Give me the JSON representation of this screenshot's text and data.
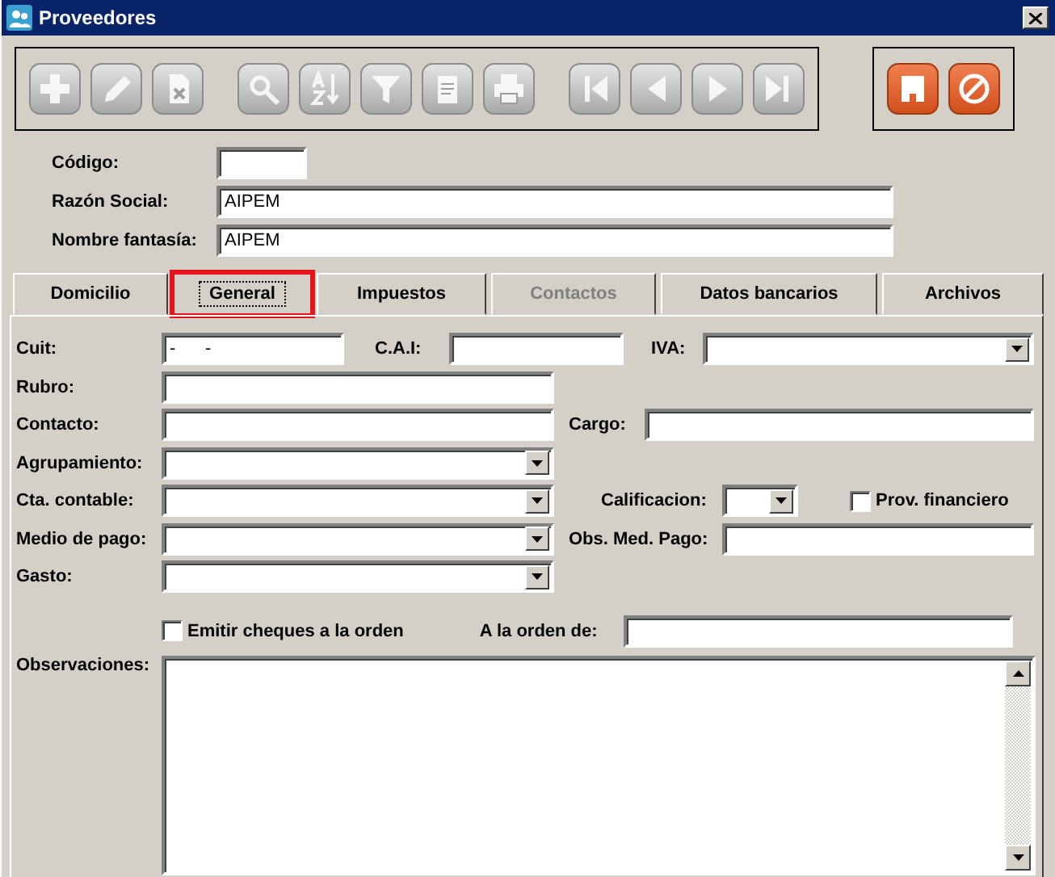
{
  "window": {
    "title": "Proveedores"
  },
  "toolbar": {
    "frames": [
      {
        "groups": [
          {
            "buttons": [
              {
                "disabled": true
              },
              {
                "disabled": true
              },
              {
                "disabled": true
              }
            ]
          },
          {
            "buttons": [
              {
                "disabled": true
              },
              {
                "disabled": true
              },
              {
                "disabled": true
              },
              {
                "disabled": true
              },
              {
                "disabled": true
              }
            ]
          },
          {
            "buttons": [
              {
                "disabled": true
              },
              {
                "disabled": true
              },
              {
                "disabled": true
              },
              {
                "disabled": true
              }
            ]
          }
        ]
      },
      {
        "groups": [
          {
            "buttons": [
              {
                "disabled": false
              },
              {
                "disabled": false
              }
            ]
          }
        ]
      }
    ]
  },
  "header_fields": [
    {
      "label": "Código:"
    },
    {
      "label": "Razón Social:",
      "value": "AIPEM"
    },
    {
      "label": "Nombre fantasía:",
      "value": "AIPEM"
    }
  ],
  "tabs": [
    {
      "label": "Domicilio",
      "selected": false,
      "disabled": false,
      "highlighted": false
    },
    {
      "label": "General",
      "selected": true,
      "disabled": false,
      "highlighted": true
    },
    {
      "label": "Impuestos",
      "selected": false,
      "disabled": false,
      "highlighted": false
    },
    {
      "label": "Contactos",
      "selected": false,
      "disabled": true,
      "highlighted": false
    },
    {
      "label": "Datos bancarios",
      "selected": false,
      "disabled": false,
      "highlighted": false
    },
    {
      "label": "Archivos",
      "selected": false,
      "disabled": false,
      "highlighted": false
    }
  ],
  "general": {
    "cuit": {
      "label": "Cuit:",
      "value": "-      -"
    },
    "cai": {
      "label": "C.A.I:"
    },
    "iva": {
      "label": "IVA:"
    },
    "rubro": {
      "label": "Rubro:"
    },
    "contacto": {
      "label": "Contacto:"
    },
    "cargo": {
      "label": "Cargo:"
    },
    "agrupamiento": {
      "label": "Agrupamiento:"
    },
    "cta_contable": {
      "label": "Cta. contable:"
    },
    "calificacion": {
      "label": "Calificacion:"
    },
    "prov_financiero": {
      "label": "Prov. financiero",
      "checked": false
    },
    "medio_pago": {
      "label": "Medio de pago:"
    },
    "obs_med_pago": {
      "label": "Obs. Med. Pago:"
    },
    "gasto": {
      "label": "Gasto:"
    },
    "emitir_cheques": {
      "label": "Emitir cheques a la orden",
      "checked": false
    },
    "a_la_orden": {
      "label": "A la orden de:"
    },
    "observaciones": {
      "label": "Observaciones:"
    }
  }
}
